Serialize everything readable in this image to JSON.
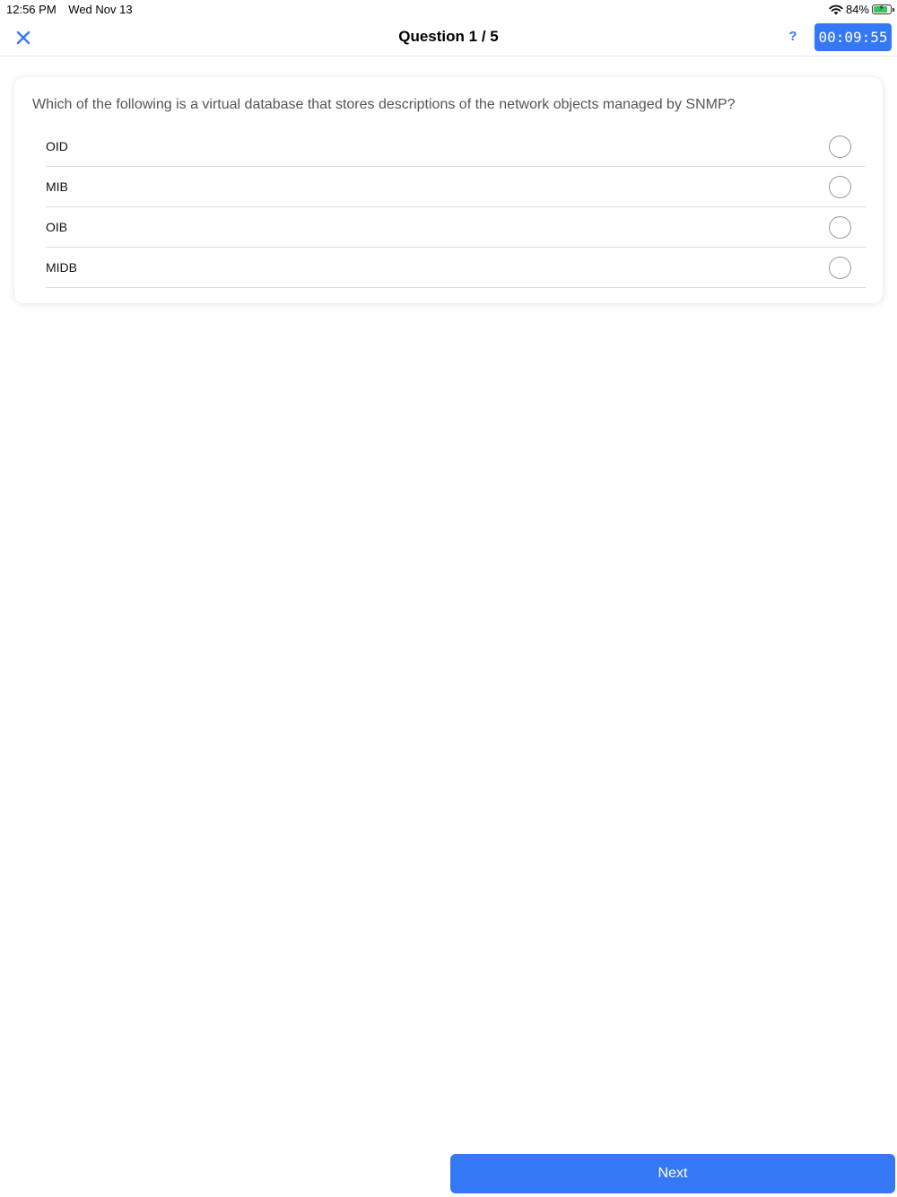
{
  "status_bar": {
    "time": "12:56 PM",
    "date": "Wed Nov 13",
    "battery_percent": "84%",
    "battery_level": 0.84
  },
  "nav": {
    "close_icon": "close-icon",
    "title": "Question 1 / 5",
    "help_label": "?",
    "timer": "00:09:55"
  },
  "question": {
    "text": "Which of the following is a virtual database that stores descriptions of the network objects managed by SNMP?",
    "options": [
      {
        "label": "OID",
        "selected": false
      },
      {
        "label": "MIB",
        "selected": false
      },
      {
        "label": "OIB",
        "selected": false
      },
      {
        "label": "MIDB",
        "selected": false
      }
    ]
  },
  "footer": {
    "next_label": "Next"
  },
  "colors": {
    "accent": "#3478f6",
    "battery": "#34c759"
  }
}
